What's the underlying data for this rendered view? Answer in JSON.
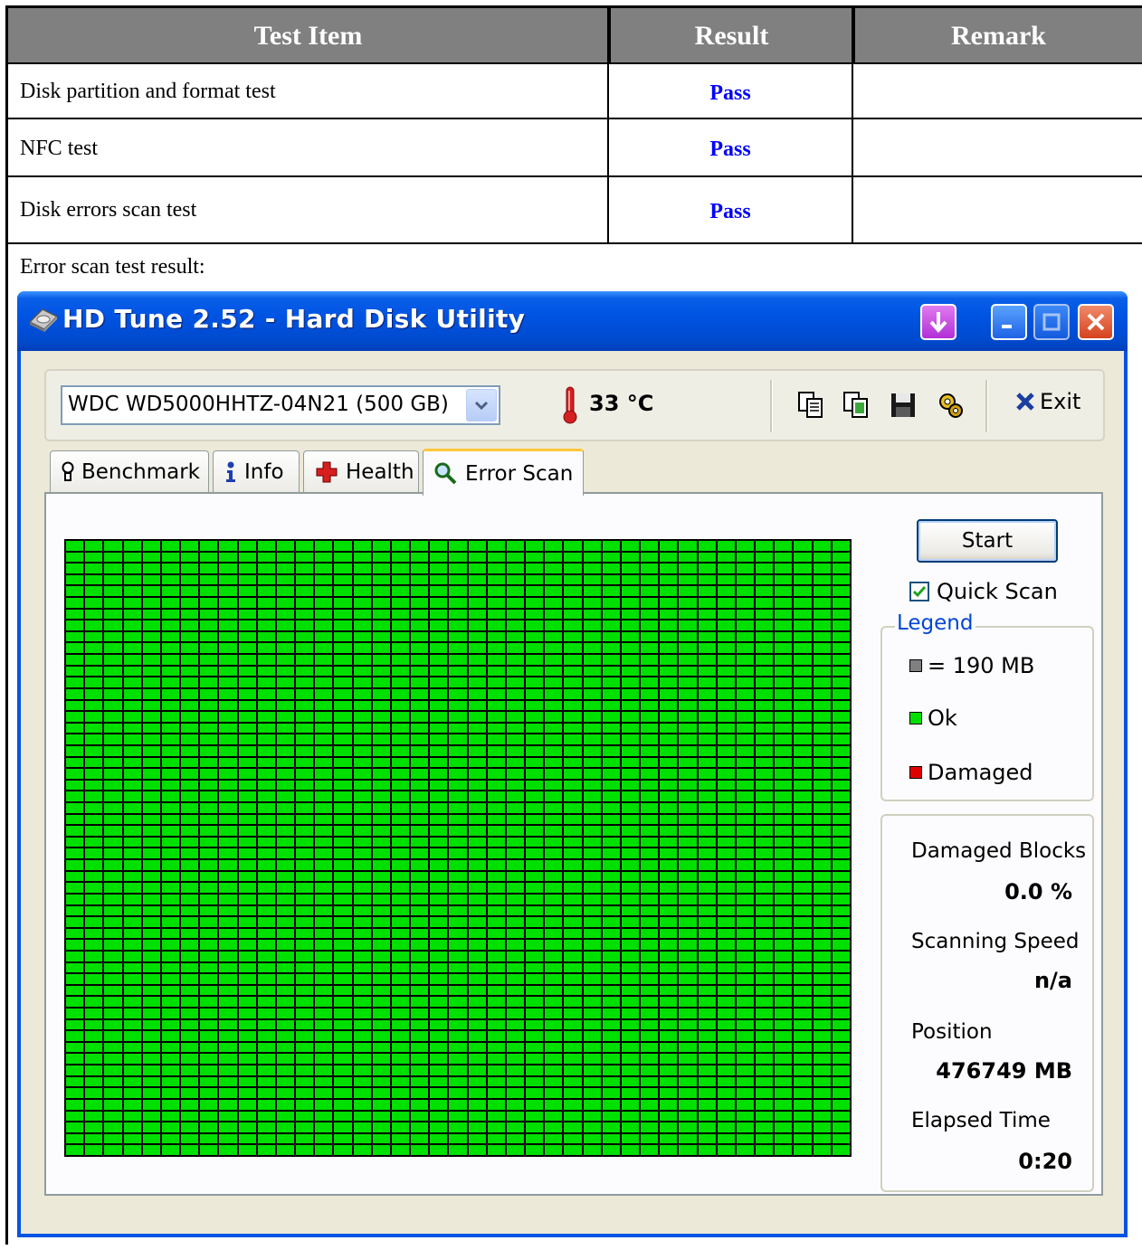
{
  "report": {
    "headers": {
      "test_item": "Test Item",
      "result": "Result",
      "remark": "Remark"
    },
    "rows": [
      {
        "item": "Disk partition and format test",
        "result": "Pass",
        "remark": ""
      },
      {
        "item": "NFC test",
        "result": "Pass",
        "remark": ""
      },
      {
        "item": "Disk errors scan test",
        "result": "Pass",
        "remark": ""
      }
    ],
    "error_scan_caption": "Error scan test result:",
    "pass_color": "#0000ff",
    "header_bg": "#808080"
  },
  "window": {
    "title": "HD Tune 2.52 - Hard Disk Utility",
    "title_bar_color": "#0054e3",
    "drive_select": {
      "value": "WDC WD5000HHTZ-04N21 (500 GB)"
    },
    "temperature": "33 °C",
    "toolbar_icons": [
      "copy-text-icon",
      "copy-screenshot-icon",
      "save-icon",
      "options-icon"
    ],
    "exit_label": "Exit",
    "tabs": [
      {
        "label": "Benchmark",
        "icon": "lightbulb-icon",
        "active": false
      },
      {
        "label": "Info",
        "icon": "info-icon",
        "active": false
      },
      {
        "label": "Health",
        "icon": "health-cross-icon",
        "active": false
      },
      {
        "label": "Error Scan",
        "icon": "magnifier-icon",
        "active": true
      }
    ],
    "error_scan": {
      "start_label": "Start",
      "quick_scan_label": "Quick Scan",
      "quick_scan_checked": true,
      "legend": {
        "title": "Legend",
        "block_size": "= 190 MB",
        "ok_label": "Ok",
        "damaged_label": "Damaged",
        "block_color": "#808080",
        "ok_color": "#00e000",
        "damaged_color": "#e00000"
      },
      "stats": {
        "damaged_blocks_label": "Damaged Blocks",
        "damaged_blocks_value": "0.0 %",
        "scanning_speed_label": "Scanning Speed",
        "scanning_speed_value": "n/a",
        "position_label": "Position",
        "position_value": "476749 MB",
        "elapsed_time_label": "Elapsed Time",
        "elapsed_time_value": "0:20"
      },
      "block_map": {
        "status": "all ok",
        "ok_fraction": 1.0
      }
    }
  }
}
